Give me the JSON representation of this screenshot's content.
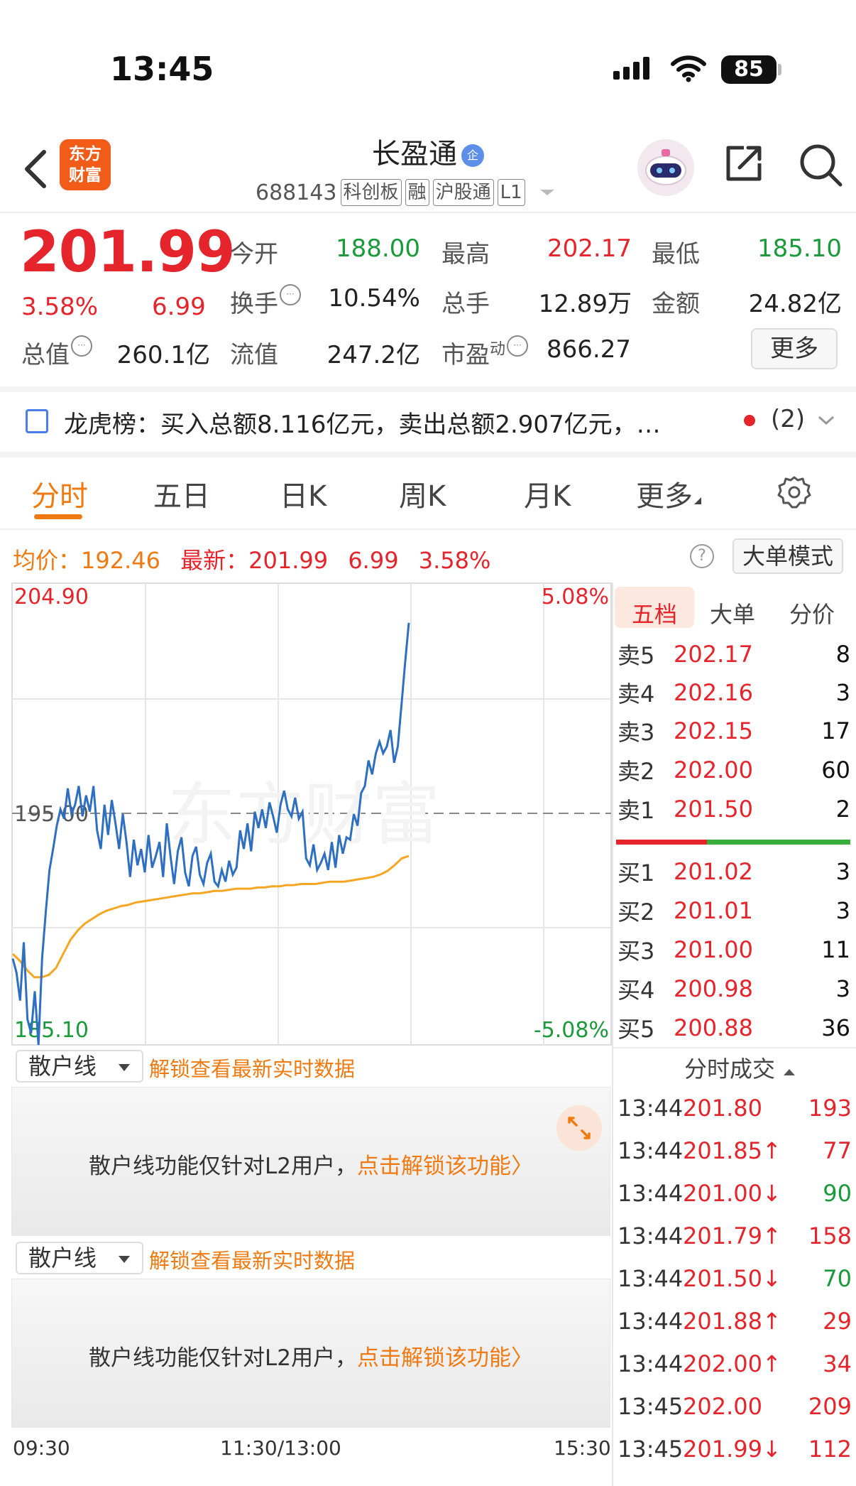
{
  "status_bar": {
    "time": "13:45",
    "battery": "85"
  },
  "header": {
    "logo_line1": "东方",
    "logo_line2": "财富",
    "stock_name": "长盈通",
    "badge": "企",
    "stock_code": "688143",
    "tags": [
      "科创板",
      "融",
      "沪股通",
      "L1"
    ]
  },
  "quote": {
    "price": "201.99",
    "change_pct": "3.58%",
    "change": "6.99",
    "open_label": "今开",
    "open": "188.00",
    "high_label": "最高",
    "high": "202.17",
    "low_label": "最低",
    "low": "185.10",
    "turnover_label": "换手",
    "turnover": "10.54%",
    "volume_label": "总手",
    "volume": "12.89万",
    "amount_label": "金额",
    "amount": "24.82亿",
    "mktcap_label": "总值",
    "mktcap": "260.1亿",
    "float_label": "流值",
    "float_cap": "247.2亿",
    "pe_label": "市盈",
    "pe_sup": "动",
    "pe": "866.27",
    "more": "更多"
  },
  "dragon_tiger": {
    "text": "龙虎榜：买入总额8.116亿元，卖出总额2.907亿元，…",
    "count": "(2)"
  },
  "tabs": [
    "分时",
    "五日",
    "日K",
    "周K",
    "月K",
    "更多"
  ],
  "chart_header": {
    "avg_label": "均价：",
    "avg": "192.46",
    "latest_label": "最新：",
    "latest": "201.99",
    "latest_chg": "6.99",
    "latest_pct": "3.58%",
    "help": "?",
    "big_order_mode": "大单模式"
  },
  "chart_labels": {
    "y_max": "204.90",
    "y_mid": "195.00",
    "y_min": "185.10",
    "pct_max": "5.08%",
    "pct_min": "-5.08%",
    "watermark": "东方财富",
    "t_start": "09:30",
    "t_mid": "11:30/13:00",
    "t_end": "15:30"
  },
  "chart_data": {
    "type": "line",
    "ylim": [
      185.1,
      204.9
    ],
    "x": [
      "09:30",
      "11:30/13:00",
      "15:30"
    ],
    "series": [
      {
        "name": "",
        "color": "#2f6fc1",
        "values": [
          188.8,
          188.2,
          187.0,
          189.5,
          186.2,
          185.6,
          187.4,
          185.1,
          188.8,
          190.8,
          192.6,
          193.5,
          194.5,
          195.2,
          194.8,
          196.1,
          195.0,
          195.4,
          196.2,
          194.9,
          195.8,
          195.1,
          196.2,
          194.3,
          193.5,
          195.4,
          194.1,
          195.6,
          194.6,
          193.5,
          195.0,
          193.8,
          192.3,
          193.9,
          192.8,
          193.5,
          192.5,
          194.1,
          192.7,
          193.2,
          193.8,
          192.3,
          194.6,
          193.2,
          192.0,
          193.4,
          194.0,
          192.5,
          191.9,
          193.2,
          193.6,
          192.4,
          192.0,
          192.9,
          193.3,
          192.1,
          191.9,
          192.6,
          192.1,
          193.0,
          192.4,
          192.7,
          194.3,
          193.5,
          194.6,
          193.4,
          195.1,
          194.4,
          195.2,
          194.4,
          195.5,
          194.9,
          194.2,
          195.4,
          196.0,
          195.2,
          194.9,
          195.7,
          194.8,
          195.1,
          193.1,
          192.8,
          193.7,
          192.6,
          192.9,
          193.3,
          192.6,
          193.8,
          192.7,
          194.1,
          193.3,
          194.0,
          193.9,
          195.0,
          194.5,
          195.9,
          196.2,
          197.3,
          196.7,
          197.6,
          198.1,
          197.6,
          197.9,
          198.6,
          197.2,
          197.9,
          199.7,
          201.5,
          203.2
        ]
      },
      {
        "name": "",
        "color": "#f5a623",
        "values": [
          189.0,
          188.7,
          188.3,
          188.0,
          188.0,
          188.1,
          188.4,
          189.0,
          189.6,
          190.0,
          190.3,
          190.5,
          190.7,
          190.85,
          190.95,
          191.05,
          191.1,
          191.2,
          191.25,
          191.3,
          191.35,
          191.4,
          191.45,
          191.5,
          191.55,
          191.6,
          191.6,
          191.65,
          191.7,
          191.7,
          191.75,
          191.8,
          191.8,
          191.8,
          191.85,
          191.85,
          191.9,
          191.9,
          191.95,
          191.95,
          192.0,
          192.0,
          192.0,
          192.05,
          192.1,
          192.1,
          192.1,
          192.15,
          192.2,
          192.25,
          192.3,
          192.4,
          192.55,
          192.8,
          193.1,
          193.2
        ]
      }
    ]
  },
  "orderbook": {
    "tabs": [
      "五档",
      "大单",
      "分价"
    ],
    "asks": [
      {
        "label": "卖5",
        "price": "202.17",
        "qty": "8"
      },
      {
        "label": "卖4",
        "price": "202.16",
        "qty": "3"
      },
      {
        "label": "卖3",
        "price": "202.15",
        "qty": "17"
      },
      {
        "label": "卖2",
        "price": "202.00",
        "qty": "60"
      },
      {
        "label": "卖1",
        "price": "201.50",
        "qty": "2"
      }
    ],
    "bids": [
      {
        "label": "买1",
        "price": "201.02",
        "qty": "3"
      },
      {
        "label": "买2",
        "price": "201.01",
        "qty": "3"
      },
      {
        "label": "买3",
        "price": "201.00",
        "qty": "11"
      },
      {
        "label": "买4",
        "price": "200.98",
        "qty": "3"
      },
      {
        "label": "买5",
        "price": "200.88",
        "qty": "36"
      }
    ],
    "trades_title": "分时成交",
    "trades": [
      {
        "time": "13:44",
        "price": "201.80",
        "dir": "",
        "qty": "193",
        "color": "red"
      },
      {
        "time": "13:44",
        "price": "201.85↑",
        "dir": "up",
        "qty": "77",
        "color": "red"
      },
      {
        "time": "13:44",
        "price": "201.00↓",
        "dir": "down",
        "qty": "90",
        "color": "green"
      },
      {
        "time": "13:44",
        "price": "201.79↑",
        "dir": "up",
        "qty": "158",
        "color": "red"
      },
      {
        "time": "13:44",
        "price": "201.50↓",
        "dir": "down",
        "qty": "70",
        "color": "green"
      },
      {
        "time": "13:44",
        "price": "201.88↑",
        "dir": "up",
        "qty": "29",
        "color": "red"
      },
      {
        "time": "13:44",
        "price": "202.00↑",
        "dir": "up",
        "qty": "34",
        "color": "red"
      },
      {
        "time": "13:45",
        "price": "202.00",
        "dir": "",
        "qty": "209",
        "color": "red"
      },
      {
        "time": "13:45",
        "price": "201.99↓",
        "dir": "down",
        "qty": "112",
        "color": "red"
      }
    ]
  },
  "panels": [
    {
      "dropdown": "散户线",
      "unlock": "解锁查看最新实时数据",
      "text_prefix": "散户线功能仅针对L2用户，",
      "text_link": "点击解锁该功能〉"
    },
    {
      "dropdown": "散户线",
      "unlock": "解锁查看最新实时数据",
      "text_prefix": "散户线功能仅针对L2用户，",
      "text_link": "点击解锁该功能〉"
    }
  ]
}
